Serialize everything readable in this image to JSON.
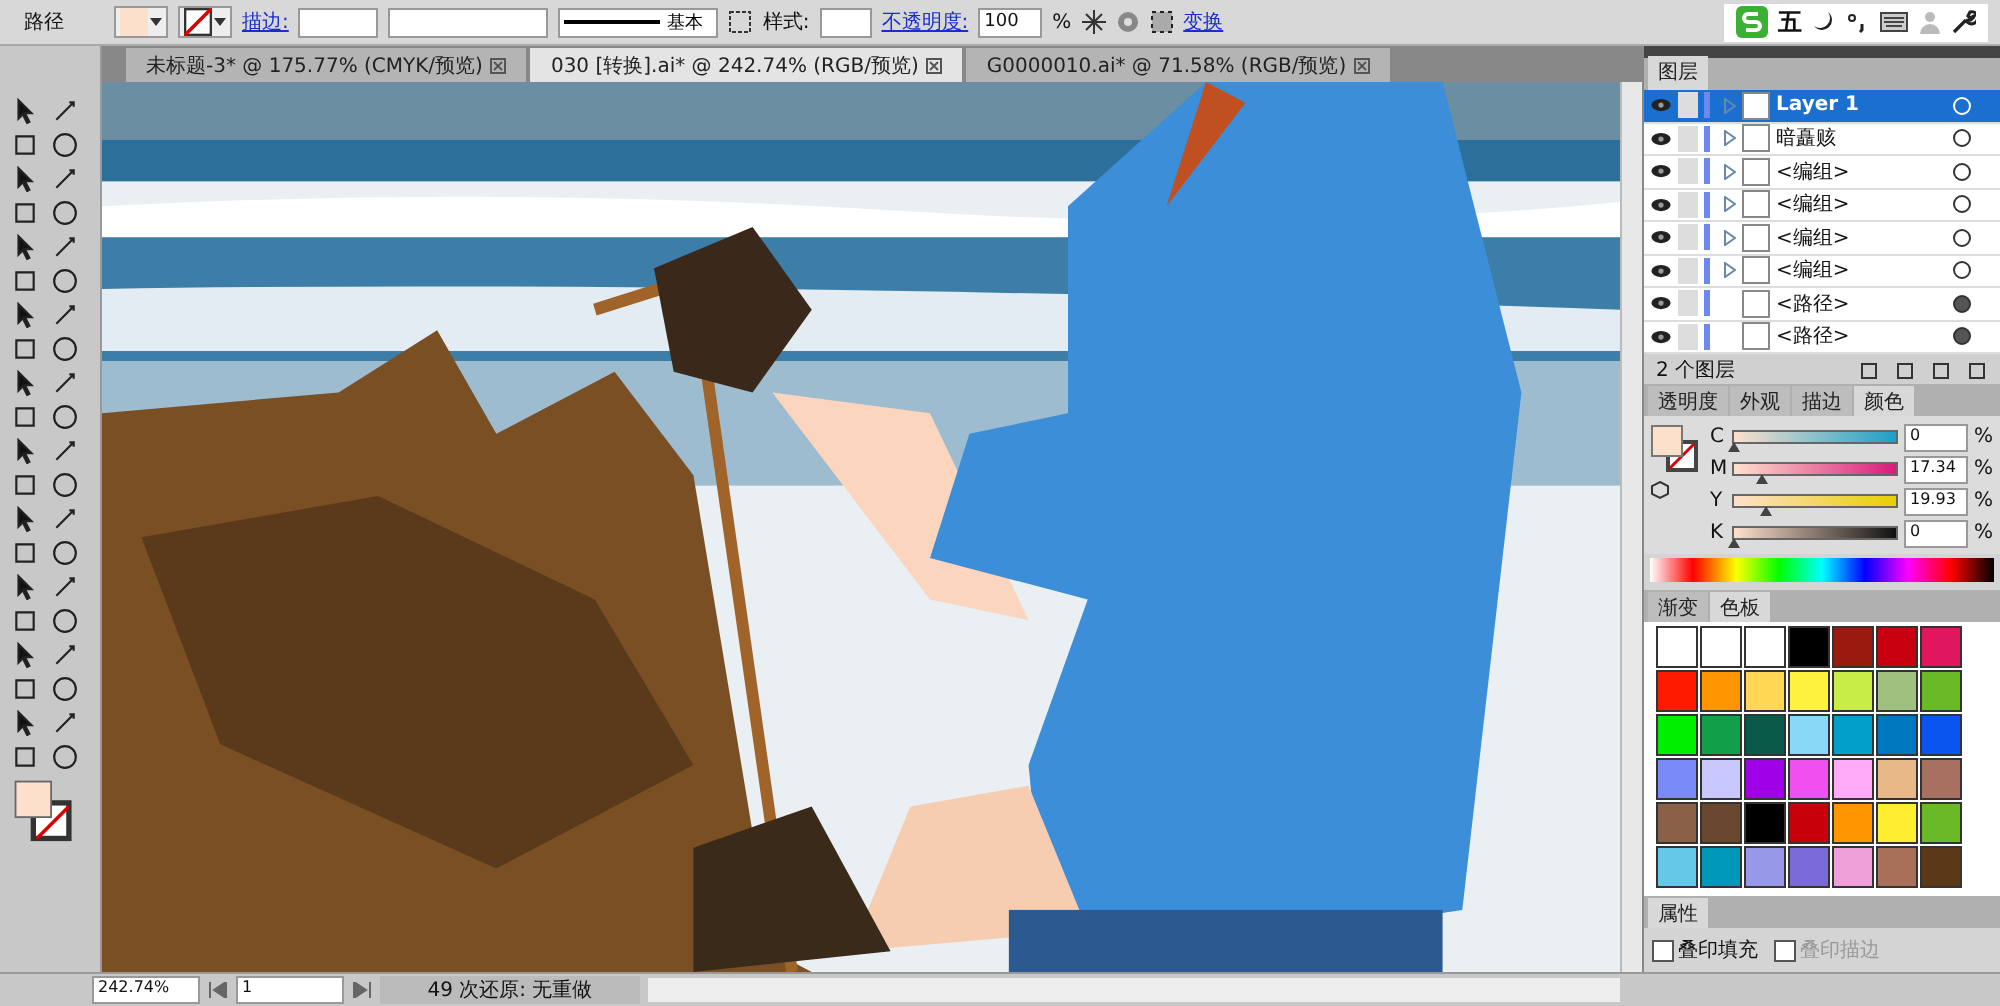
{
  "control_bar": {
    "object_type": "路径",
    "stroke_label": "描边:",
    "stroke_profile": "基本",
    "style_label": "样式:",
    "opacity_label": "不透明度:",
    "opacity_value": "100",
    "opacity_unit": "%",
    "transform_link": "变换"
  },
  "ime_bar": {
    "mode": "五"
  },
  "doc_tabs": [
    {
      "label": "未标题-3* @ 175.77% (CMYK/预览)",
      "selected": false
    },
    {
      "label": "030 [转换].ai* @ 242.74% (RGB/预览)",
      "selected": true
    },
    {
      "label": "G0000010.ai* @ 71.58% (RGB/预览)",
      "selected": false
    }
  ],
  "layers_panel": {
    "title": "图层",
    "rows": [
      {
        "name": "Layer 1",
        "selected": true,
        "expandable": true,
        "has_appearance": false
      },
      {
        "name": "暗矗赅",
        "selected": false,
        "expandable": true,
        "has_appearance": false
      },
      {
        "name": "<编组>",
        "selected": false,
        "expandable": true,
        "has_appearance": false
      },
      {
        "name": "<编组>",
        "selected": false,
        "expandable": true,
        "has_appearance": false
      },
      {
        "name": "<编组>",
        "selected": false,
        "expandable": true,
        "has_appearance": false
      },
      {
        "name": "<编组>",
        "selected": false,
        "expandable": true,
        "has_appearance": false
      },
      {
        "name": "<路径>",
        "selected": false,
        "expandable": false,
        "has_appearance": true
      },
      {
        "name": "<路径>",
        "selected": false,
        "expandable": false,
        "has_appearance": true
      }
    ],
    "count": "2 个图层"
  },
  "color_panel": {
    "tabs": [
      {
        "label": "透明度",
        "selected": false
      },
      {
        "label": "外观",
        "selected": false
      },
      {
        "label": "描边",
        "selected": false
      },
      {
        "label": "颜色",
        "selected": true
      }
    ],
    "channels": [
      {
        "name": "C",
        "value": "0",
        "level": 0
      },
      {
        "name": "M",
        "value": "17.34",
        "level": 0.1734
      },
      {
        "name": "Y",
        "value": "19.93",
        "level": 0.1993
      },
      {
        "name": "K",
        "value": "0",
        "level": 0
      }
    ],
    "unit": "%"
  },
  "swatches_panel": {
    "tabs": [
      {
        "label": "渐变",
        "selected": false
      },
      {
        "label": "色板",
        "selected": true
      }
    ],
    "swatches": [
      {
        "color": "#ffffff"
      },
      {
        "color": "#ffffff"
      },
      {
        "color": "#ffffff"
      },
      {
        "color": "#000000"
      },
      {
        "color": "#9b1a0e"
      },
      {
        "color": "#c8000f"
      },
      {
        "color": "#e0175f"
      },
      {
        "color": "#ff1a00"
      },
      {
        "color": "#ff9600"
      },
      {
        "color": "#ffd755"
      },
      {
        "color": "#fff23c"
      },
      {
        "color": "#c8ee46"
      },
      {
        "color": "#a0c080"
      },
      {
        "color": "#6aba28"
      },
      {
        "color": "#00ee00"
      },
      {
        "color": "#11a049"
      },
      {
        "color": "#0a5a4a"
      },
      {
        "color": "#8ad8f8"
      },
      {
        "color": "#00a0c8"
      },
      {
        "color": "#0078c0"
      },
      {
        "color": "#0a55f0"
      },
      {
        "color": "#7a8af8"
      },
      {
        "color": "#c8c8ff"
      },
      {
        "color": "#a000e8"
      },
      {
        "color": "#f050f0"
      },
      {
        "color": "#ffaaf8"
      },
      {
        "color": "#e8b888"
      },
      {
        "color": "#a87060"
      },
      {
        "color": "#8a6048"
      },
      {
        "color": "#6a4830"
      },
      {
        "color": "#000000"
      },
      {
        "color": "#c8000a"
      },
      {
        "color": "#ff9600"
      },
      {
        "color": "#ffee30"
      },
      {
        "color": "#6aba28"
      },
      {
        "color": "#66c8e8"
      },
      {
        "color": "#0098b8"
      },
      {
        "color": "#9898e8"
      },
      {
        "color": "#7a6ad8"
      },
      {
        "color": "#f0a0d8"
      },
      {
        "color": "#a87058"
      },
      {
        "color": "#5a3818"
      }
    ]
  },
  "attributes_panel": {
    "tabs": [
      {
        "label": "属性",
        "selected": true
      }
    ],
    "options": [
      {
        "label": "叠印填充",
        "checked": false,
        "disabled": false
      },
      {
        "label": "叠印描边",
        "checked": false,
        "disabled": true
      }
    ]
  },
  "status_bar": {
    "zoom": "242.74%",
    "page": "1",
    "message": "49 次还原: 无重做"
  }
}
